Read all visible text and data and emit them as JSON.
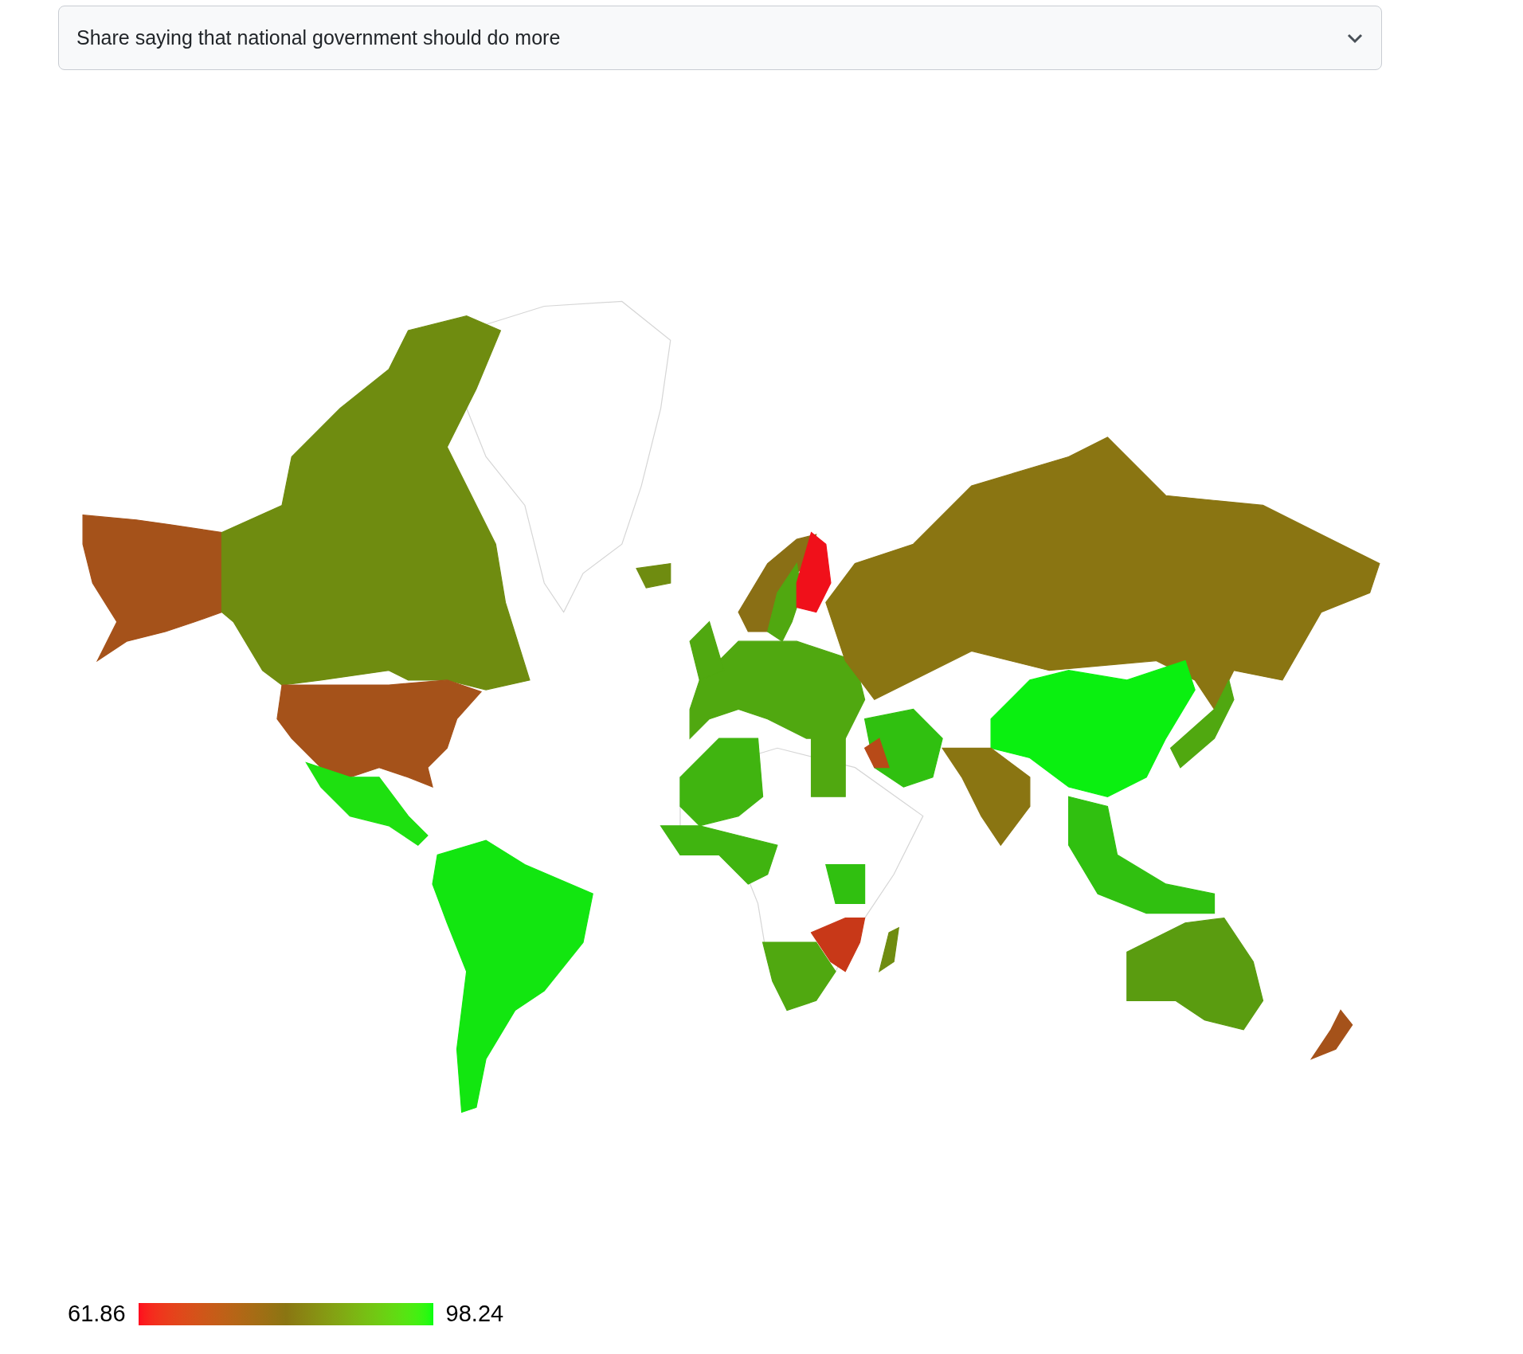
{
  "dropdown": {
    "value": "Share saying that national government should do more"
  },
  "legend": {
    "min": "61.86",
    "max": "98.24"
  }
}
